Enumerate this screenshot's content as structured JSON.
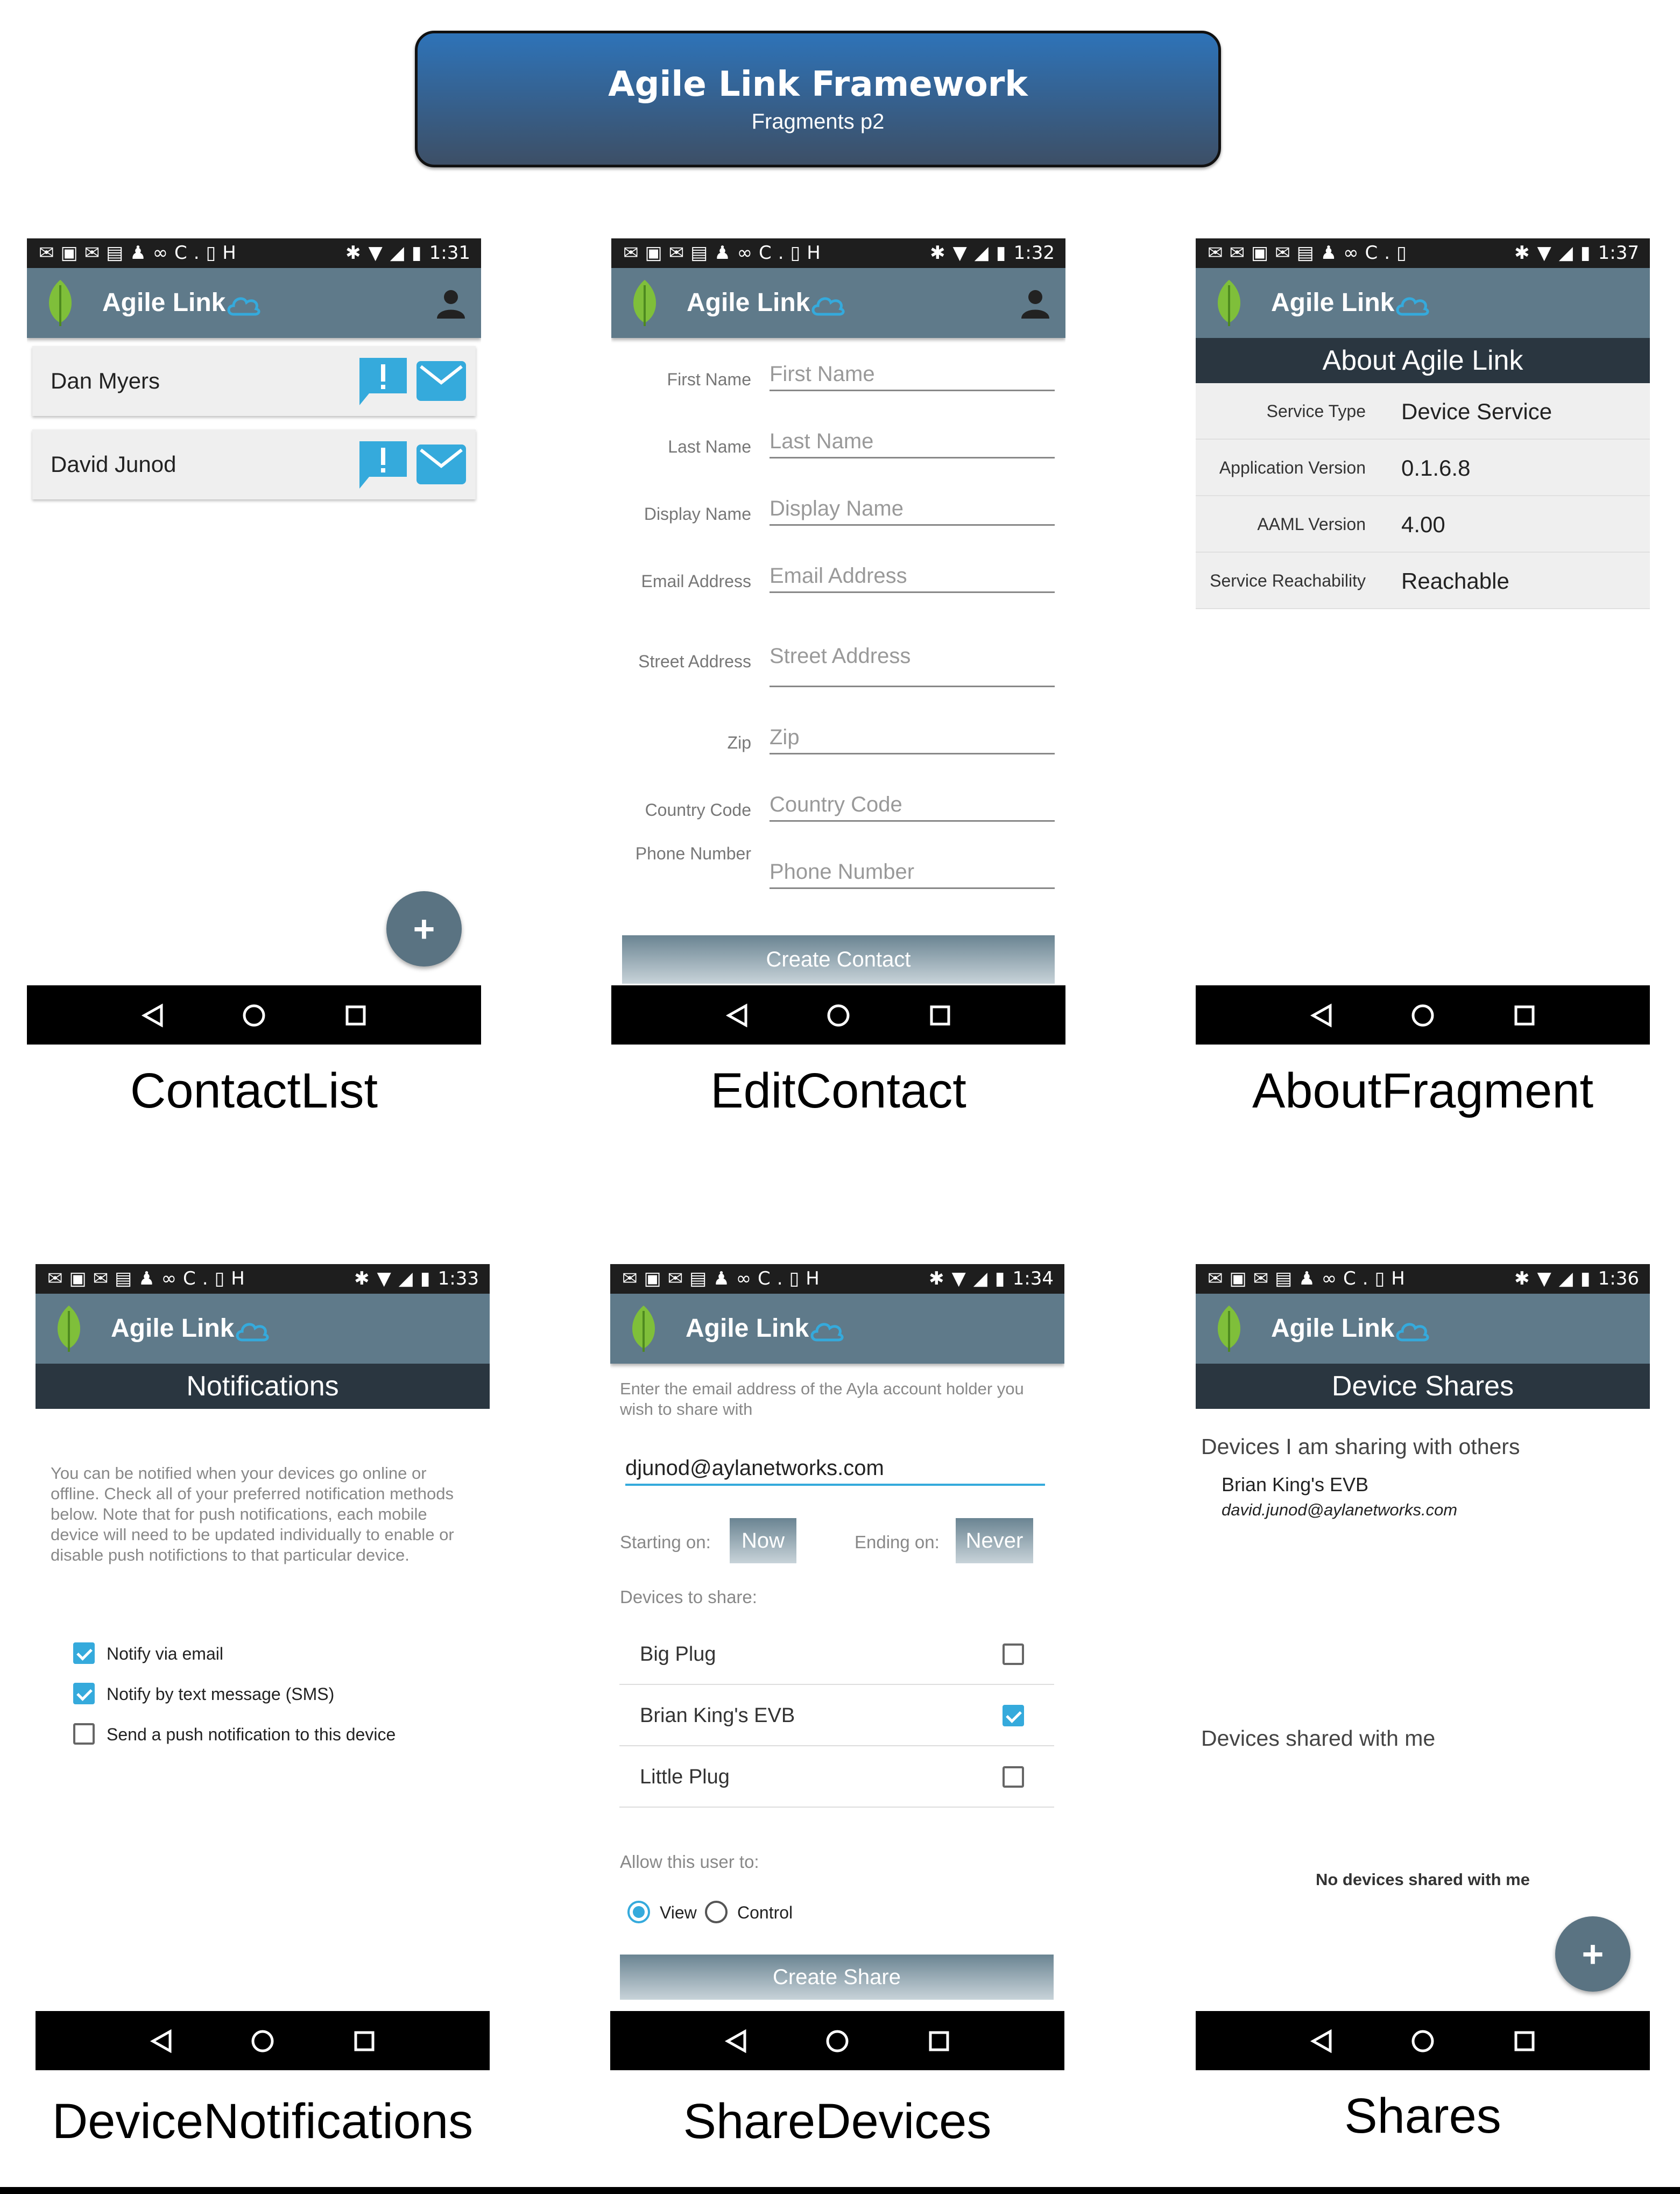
{
  "banner": {
    "title": "Agile Link Framework",
    "subtitle": "Fragments p2"
  },
  "app_title": "Agile Link",
  "phones": {
    "contact_list": {
      "time": "1:31",
      "caption": "ContactList",
      "contacts": [
        {
          "name": "Dan Myers"
        },
        {
          "name": "David Junod"
        }
      ],
      "fab": "+"
    },
    "edit_contact": {
      "time": "1:32",
      "caption": "EditContact",
      "fields": [
        {
          "label": "First Name",
          "placeholder": "First Name"
        },
        {
          "label": "Last Name",
          "placeholder": "Last Name"
        },
        {
          "label": "Display Name",
          "placeholder": "Display Name"
        },
        {
          "label": "Email Address",
          "placeholder": "Email Address"
        },
        {
          "label": "Street Address",
          "placeholder": "Street Address"
        },
        {
          "label": "Zip",
          "placeholder": "Zip"
        },
        {
          "label": "Country Code",
          "placeholder": "Country Code"
        },
        {
          "label": "Phone Number",
          "placeholder": "Phone Number"
        }
      ],
      "button": "Create Contact"
    },
    "about": {
      "time": "1:37",
      "caption": "AboutFragment",
      "header": "About Agile Link",
      "rows": [
        {
          "key": "Service Type",
          "value": "Device Service"
        },
        {
          "key": "Application Version",
          "value": "0.1.6.8"
        },
        {
          "key": "AAML Version",
          "value": "4.00"
        },
        {
          "key": "Service Reachability",
          "value": "Reachable"
        }
      ]
    },
    "notifications": {
      "time": "1:33",
      "caption": "DeviceNotifications",
      "header": "Notifications",
      "description": "You can be notified when your devices go online or offline. Check all of your preferred notification methods below. Note that for push notifications, each mobile device will need to be updated individually to enable or disable push notifictions to that particular device.",
      "options": [
        {
          "label": "Notify via email",
          "checked": true
        },
        {
          "label": "Notify by text message (SMS)",
          "checked": true
        },
        {
          "label": "Send a push notification to this device",
          "checked": false
        }
      ]
    },
    "share_devices": {
      "time": "1:34",
      "caption": "ShareDevices",
      "instructions": "Enter the email address of the Ayla account holder you wish to share with",
      "email": "djunod@aylanetworks.com",
      "starting_label": "Starting on:",
      "starting_value": "Now",
      "ending_label": "Ending on:",
      "ending_value": "Never",
      "devices_label": "Devices to share:",
      "devices": [
        {
          "name": "Big Plug",
          "checked": false
        },
        {
          "name": "Brian King's EVB",
          "checked": true
        },
        {
          "name": "Little Plug",
          "checked": false
        }
      ],
      "allow_label": "Allow this user to:",
      "permissions": [
        {
          "label": "View",
          "selected": true
        },
        {
          "label": "Control",
          "selected": false
        }
      ],
      "button": "Create Share"
    },
    "shares": {
      "time": "1:36",
      "caption": "Shares",
      "header": "Device Shares",
      "sharing_title": "Devices I am sharing with others",
      "sharing_item": {
        "device": "Brian King's EVB",
        "email": "david.junod@aylanetworks.com"
      },
      "shared_title": "Devices shared with me",
      "empty": "No devices shared with me",
      "fab": "+"
    }
  },
  "colors": {
    "app_bar": "#5f7a8a",
    "header": "#2a3640",
    "accent": "#35aadc",
    "status_bar": "#1e1e1e"
  }
}
